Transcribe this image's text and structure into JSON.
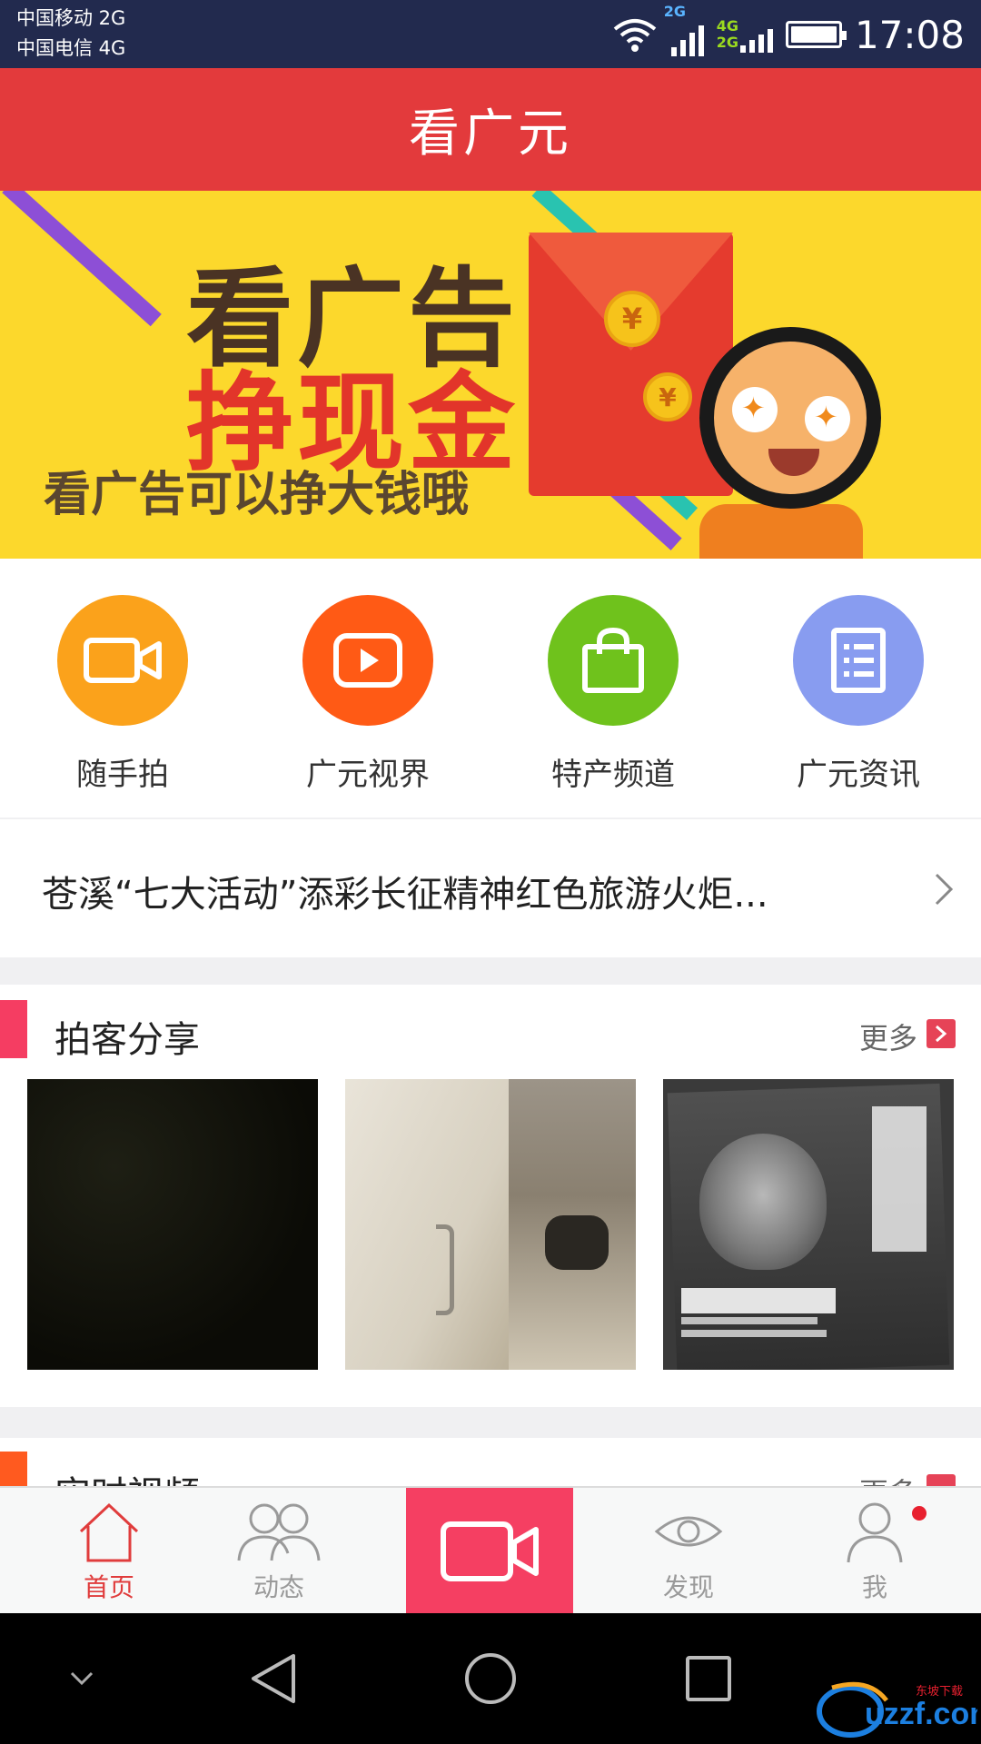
{
  "status_bar": {
    "carrier1": "中国移动 2G",
    "carrier2": "中国电信 4G",
    "net_2g": "2G",
    "net_4g": "4G",
    "net_2g_b": "2G",
    "time": "17:08"
  },
  "header": {
    "title": "看广元"
  },
  "banner": {
    "line1": "看广告",
    "line2": "挣现金",
    "subline": "看广告可以挣大钱哦",
    "coin_symbol": "¥"
  },
  "quick_nav": [
    {
      "label": "随手拍",
      "icon": "video-camera-icon",
      "color": "#fba21b"
    },
    {
      "label": "广元视界",
      "icon": "play-button-icon",
      "color": "#ff5a15"
    },
    {
      "label": "特产频道",
      "icon": "shopping-bag-icon",
      "color": "#6fc21c"
    },
    {
      "label": "广元资讯",
      "icon": "news-list-icon",
      "color": "#889cf0"
    }
  ],
  "ticker": {
    "text": "苍溪“七大活动”添彩长征精神红色旅游火炬..."
  },
  "section_paike": {
    "title": "拍客分享",
    "more": "更多"
  },
  "section_video": {
    "title": "实时视频",
    "more": "更多"
  },
  "tabs": [
    {
      "label": "首页",
      "icon": "home-icon",
      "active": true
    },
    {
      "label": "动态",
      "icon": "people-icon",
      "active": false
    },
    {
      "label": "",
      "icon": "video-camera-icon",
      "active": false
    },
    {
      "label": "发现",
      "icon": "eye-icon",
      "active": false
    },
    {
      "label": "我",
      "icon": "user-icon",
      "active": false,
      "badge": true
    }
  ],
  "colors": {
    "header_red": "#e33a3c",
    "accent_pink": "#f53f62",
    "tab_active": "#e03c3c",
    "tab_inactive": "#9a9a9a"
  },
  "watermark": {
    "text": "uzzf.com",
    "subtext": "东坡下载"
  }
}
